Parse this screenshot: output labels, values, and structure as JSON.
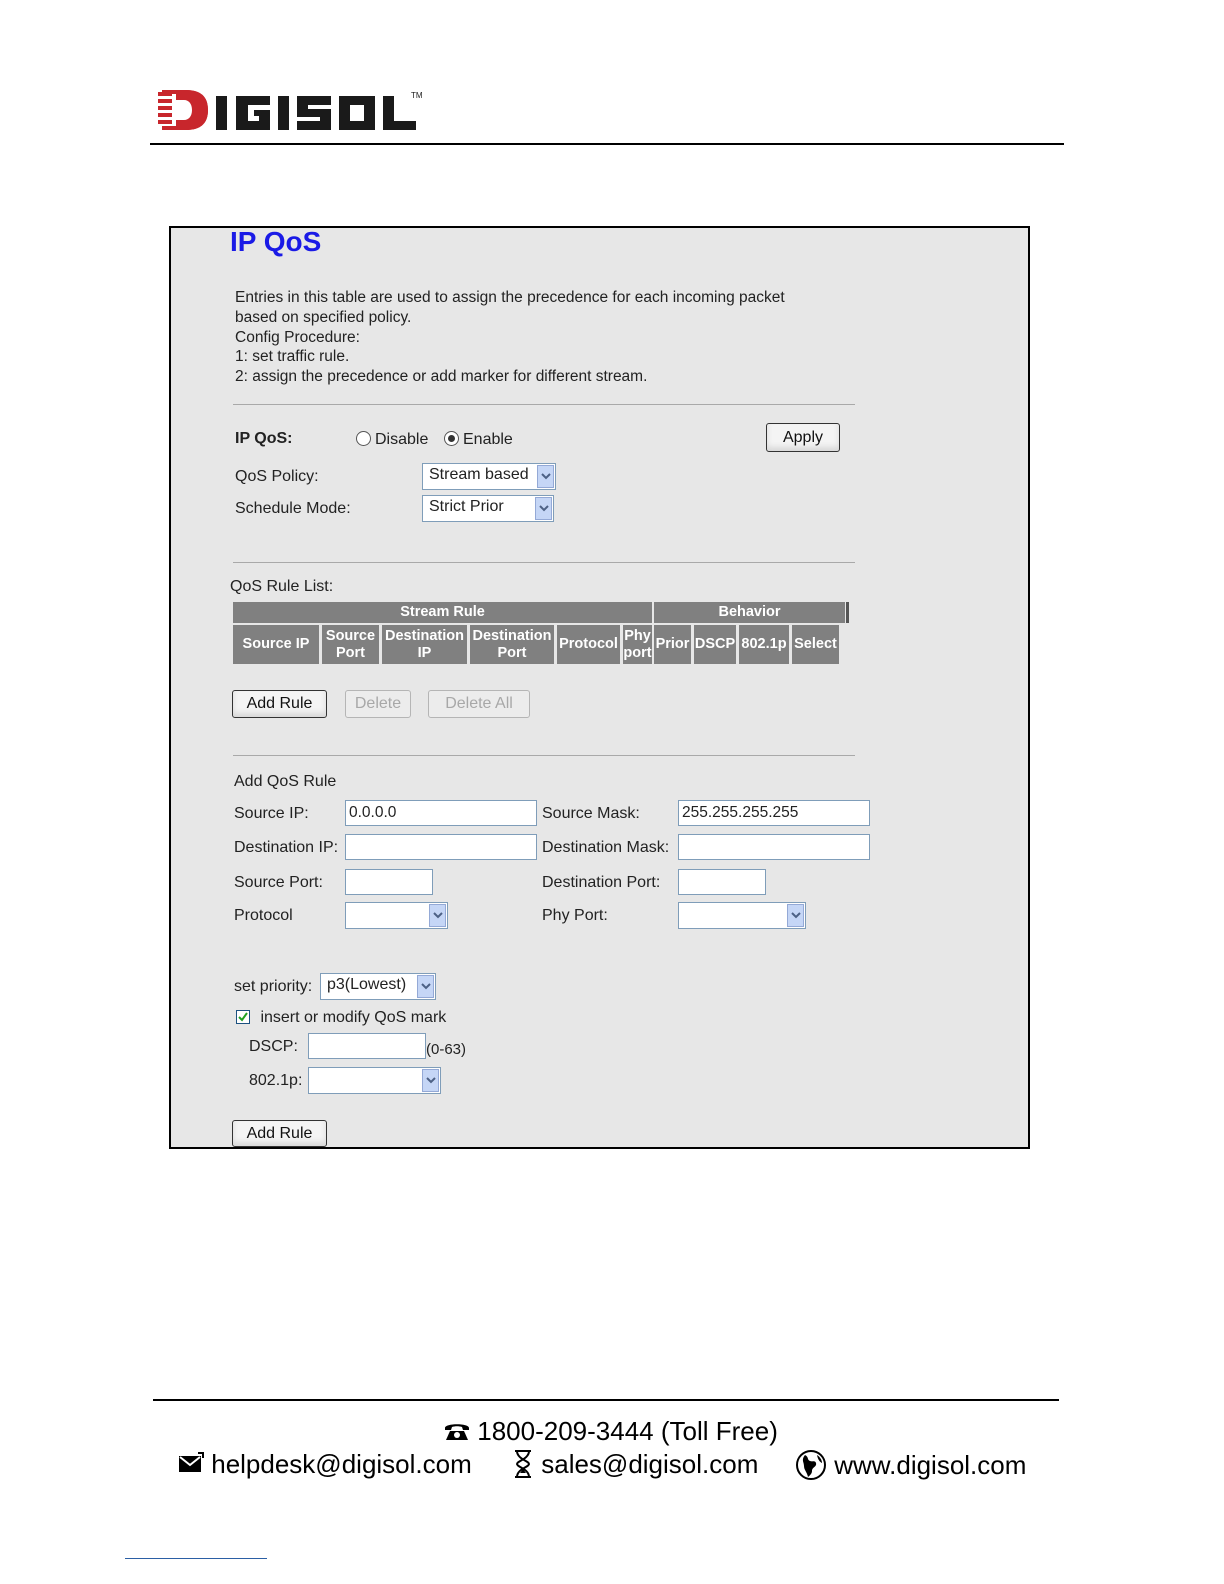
{
  "brand": {
    "name": "DIGISOL",
    "tm": "TM",
    "colors": {
      "red": "#c8262c",
      "dark": "#1a1a1a"
    }
  },
  "panel": {
    "title": "IP QoS",
    "description": [
      "Entries in this table are used to assign the precedence for each incoming packet",
      "based on specified policy.",
      "Config Procedure:",
      "1: set traffic rule.",
      "2: assign the precedence or add marker for different stream."
    ],
    "ipqos": {
      "label": "IP QoS:",
      "options": [
        {
          "label": "Disable",
          "selected": false
        },
        {
          "label": "Enable",
          "selected": true
        }
      ],
      "apply_label": "Apply"
    },
    "policy": {
      "label": "QoS Policy:",
      "value": "Stream based"
    },
    "schedule": {
      "label": "Schedule Mode:",
      "value": "Strict Prior"
    },
    "rule_list": {
      "label": "QoS Rule List:",
      "group_headers": [
        "Stream Rule",
        "Behavior"
      ],
      "columns": [
        "Source IP",
        "Source Port",
        "Destination IP",
        "Destination Port",
        "Protocol",
        "Phy port",
        "Prior",
        "DSCP",
        "802.1p",
        "Select"
      ],
      "column_lines": [
        [
          "Source IP"
        ],
        [
          "Source",
          "Port"
        ],
        [
          "Destination",
          "IP"
        ],
        [
          "Destination",
          "Port"
        ],
        [
          "Protocol"
        ],
        [
          "Phy",
          "port"
        ],
        [
          "Prior"
        ],
        [
          "DSCP"
        ],
        [
          "802.1p"
        ],
        [
          "Select"
        ]
      ],
      "rows": [],
      "buttons": {
        "add": "Add Rule",
        "delete": "Delete",
        "delete_all": "Delete All"
      }
    },
    "add_rule": {
      "heading": "Add QoS Rule",
      "source_ip": {
        "label": "Source IP:",
        "value": "0.0.0.0"
      },
      "source_mask": {
        "label": "Source Mask:",
        "value": "255.255.255.255"
      },
      "dest_ip": {
        "label": "Destination IP:",
        "value": ""
      },
      "dest_mask": {
        "label": "Destination Mask:",
        "value": ""
      },
      "source_port": {
        "label": "Source Port:",
        "value": ""
      },
      "dest_port": {
        "label": "Destination Port:",
        "value": ""
      },
      "protocol": {
        "label": "Protocol",
        "value": ""
      },
      "phy_port": {
        "label": "Phy Port:",
        "value": ""
      },
      "priority": {
        "label": "set priority:",
        "value": "p3(Lowest)"
      },
      "mark": {
        "label": "insert or modify QoS mark",
        "checked": true
      },
      "dscp": {
        "label": "DSCP:",
        "value": "",
        "hint": "(0-63)"
      },
      "dot1p": {
        "label": "802.1p:",
        "value": ""
      },
      "add_label": "Add Rule"
    }
  },
  "footer": {
    "phone": "1800-209-3444 (Toll Free)",
    "helpdesk": "helpdesk@digisol.com",
    "sales": "sales@digisol.com",
    "web": "www.digisol.com"
  }
}
